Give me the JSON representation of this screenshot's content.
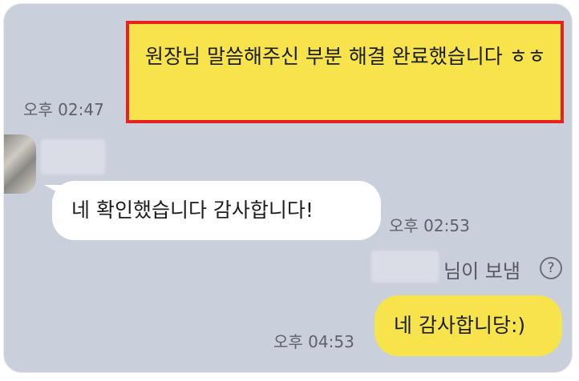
{
  "conversation": {
    "messages": [
      {
        "sender": "me",
        "text": "원장님 말씀해주신 부분 해결 완료했습니다 ㅎㅎ",
        "time": "오후 02:47",
        "highlighted": true
      },
      {
        "sender": "other",
        "text": "네 확인했습니다 감사합니다!",
        "time": "오후 02:53"
      },
      {
        "sender": "me",
        "text": "네 감사합니당:)",
        "time": "오후 04:53"
      }
    ],
    "sent_by_notice": {
      "suffix": "님이 보냄",
      "help_symbol": "?"
    }
  },
  "colors": {
    "background": "#c9d0dc",
    "my_bubble": "#f7e44c",
    "other_bubble": "#ffffff",
    "highlight_border": "#e8231f",
    "timestamp_text": "#5e6167"
  }
}
